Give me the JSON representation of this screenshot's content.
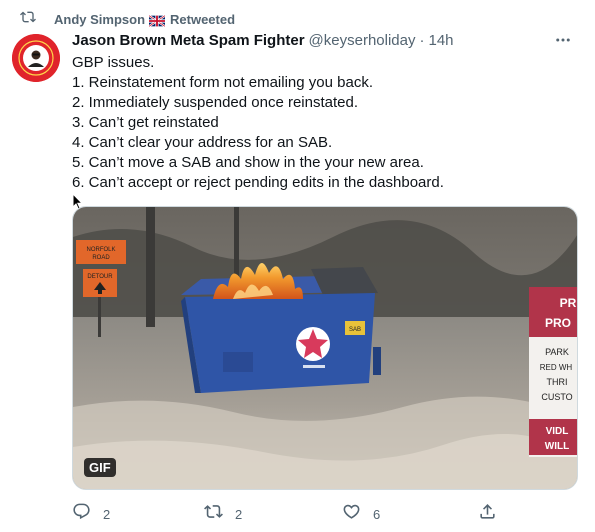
{
  "retweet": {
    "icon": "retweet-icon",
    "user": "Andy Simpson",
    "flag": "uk-flag-icon",
    "label": "Retweeted"
  },
  "tweet": {
    "avatar_icon": "avatar-badge",
    "display_name": "Jason Brown Meta Spam Fighter",
    "handle": "@keyserholiday",
    "separator": "·",
    "time": "14h",
    "lines": [
      "GBP issues.",
      "1. Reinstatement form not emailing you back.",
      "2. Immediately suspended once reinstated.",
      "3. Can’t get reinstated",
      "4. Can’t clear your address for an SAB.",
      "5. Can’t move a SAB and show in the your new area.",
      "6. Can’t accept or reject pending edits in the dashboard."
    ],
    "media": {
      "badge": "GIF",
      "signs": [
        "PR",
        "PRO",
        "PARK",
        "RED WH",
        "THRI",
        "CUSTO",
        "VIDL",
        "WILL"
      ],
      "left_signs": [
        "NORFOLK",
        "ROAD",
        "DETOUR"
      ]
    }
  },
  "actions": {
    "reply": {
      "icon": "reply-icon",
      "count": "2"
    },
    "retweet": {
      "icon": "retweet-icon",
      "count": "2"
    },
    "like": {
      "icon": "like-icon",
      "count": "6"
    },
    "share": {
      "icon": "share-icon"
    }
  },
  "colors": {
    "secondary_text": "#536471",
    "primary_text": "#0f1419",
    "avatar_red": "#e0242b"
  }
}
